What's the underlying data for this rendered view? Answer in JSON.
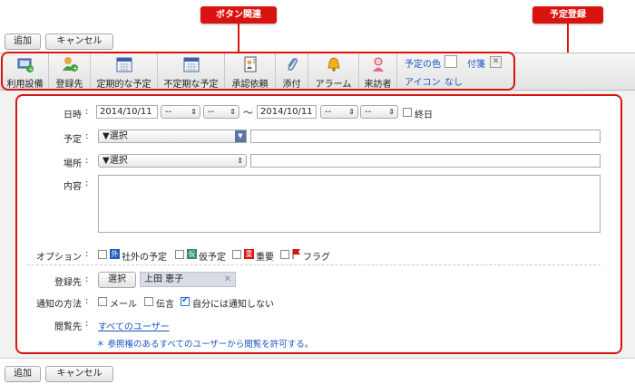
{
  "callouts": {
    "buttons": "ボタン関連",
    "registration": "予定登録"
  },
  "actions": {
    "add": "追加",
    "cancel": "キャンセル"
  },
  "toolbar": {
    "items": [
      {
        "label": "利用設備",
        "icon": "facility-icon"
      },
      {
        "label": "登録先",
        "icon": "add-user-icon"
      },
      {
        "label": "定期的な予定",
        "icon": "calendar-icon"
      },
      {
        "label": "不定期な予定",
        "icon": "calendar-icon"
      },
      {
        "label": "承認依頼",
        "icon": "approval-icon"
      },
      {
        "label": "添付",
        "icon": "paperclip-icon"
      },
      {
        "label": "アラーム",
        "icon": "bell-icon"
      },
      {
        "label": "来訪者",
        "icon": "visitor-icon"
      }
    ],
    "color_label": "予定の色",
    "sticky_label": "付箋",
    "icon_label": "アイコン",
    "icon_value": "なし"
  },
  "form": {
    "datetime": {
      "label": "日時",
      "start_date": "2014/10/11",
      "end_date": "2014/10/11",
      "hour_placeholder": "--",
      "minute_placeholder": "--",
      "tilde": "〜",
      "allday_label": "終日"
    },
    "schedule": {
      "label": "予定",
      "select_value": "▼選択"
    },
    "place": {
      "label": "場所",
      "select_value": "▼選択"
    },
    "content": {
      "label": "内容"
    },
    "options": {
      "label": "オプション",
      "items": [
        {
          "label": "社外の予定",
          "badge": "外",
          "color": "#1e5fbf"
        },
        {
          "label": "仮予定",
          "badge": "仮",
          "color": "#2a8a7a"
        },
        {
          "label": "重要",
          "badge": "重",
          "color": "#d9140f"
        },
        {
          "label": "フラグ",
          "badge": "",
          "color": "#d9140f"
        }
      ]
    },
    "registrant": {
      "label": "登録先",
      "select_button": "選択",
      "value": "上田 恵子"
    },
    "notify": {
      "label": "通知の方法",
      "items": [
        {
          "label": "メール",
          "checked": false
        },
        {
          "label": "伝言",
          "checked": false
        },
        {
          "label": "自分には通知しない",
          "checked": true
        }
      ]
    },
    "viewers": {
      "label": "閲覧先",
      "link": "すべてのユーザー",
      "note": "＊ 参照権のあるすべてのユーザーから閲覧を許可する。"
    },
    "colon": ":"
  },
  "colors": {
    "accent": "#d9140f",
    "link": "#1a55c4"
  }
}
